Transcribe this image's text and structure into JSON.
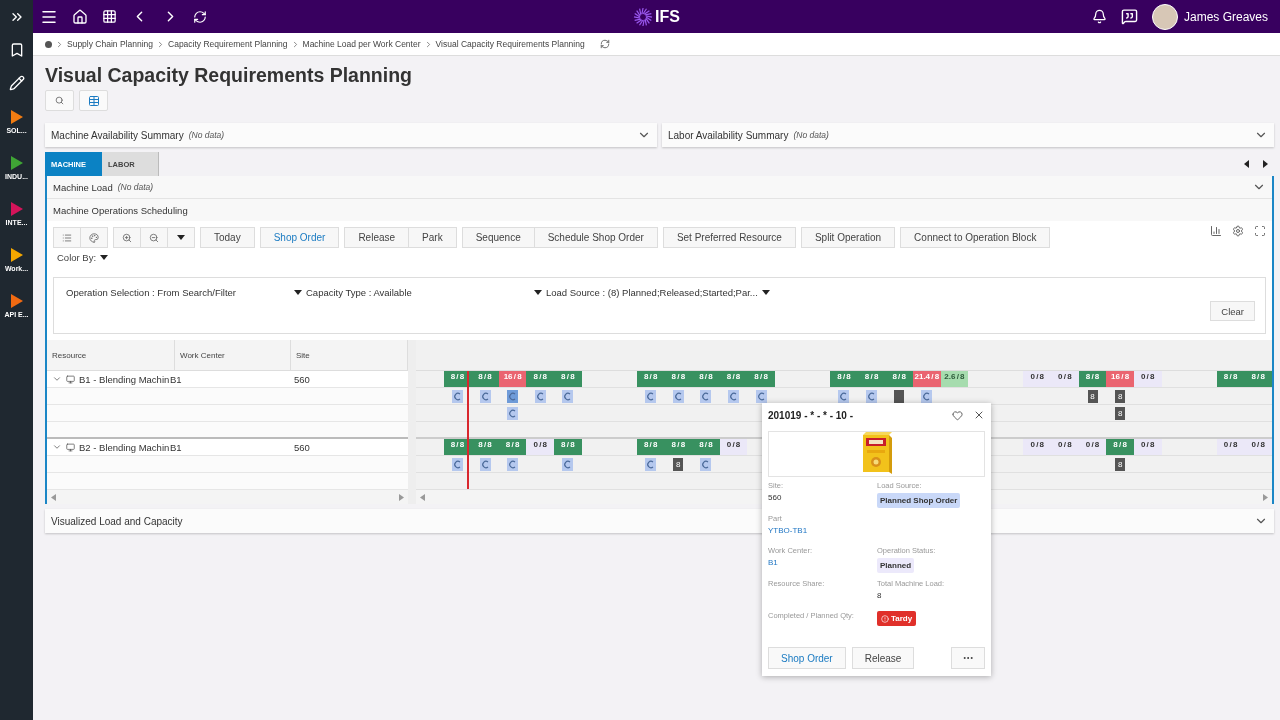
{
  "sidebar": {
    "items": [
      {
        "label": "SOL...",
        "color": "#f07c12"
      },
      {
        "label": "INDU...",
        "color": "#3fa535"
      },
      {
        "label": "INTE...",
        "color": "#d4145a"
      },
      {
        "label": "Work...",
        "color": "#f5a800"
      },
      {
        "label": "API E...",
        "color": "#f06a12"
      }
    ]
  },
  "topbar": {
    "logo": "IFS",
    "user": "James Greaves"
  },
  "breadcrumb": [
    "Supply Chain Planning",
    "Capacity Requirement Planning",
    "Machine Load per Work Center",
    "Visual Capacity Requirements Planning"
  ],
  "page": {
    "title": "Visual Capacity Requirements Planning"
  },
  "summaries": [
    {
      "title": "Machine Availability Summary",
      "note": "(No data)"
    },
    {
      "title": "Labor Availability Summary",
      "note": "(No data)"
    }
  ],
  "tabs": [
    {
      "label": "MACHINE",
      "selected": true
    },
    {
      "label": "LABOR",
      "selected": false
    }
  ],
  "machine_load": {
    "title": "Machine Load",
    "note": "(No data)"
  },
  "scheduling": {
    "title": "Machine Operations Scheduling",
    "toolbar": [
      [
        {
          "kind": "list"
        },
        {
          "kind": "palette"
        }
      ],
      [
        {
          "kind": "zoom-in"
        },
        {
          "kind": "zoom-out"
        },
        {
          "kind": "caret"
        }
      ],
      [
        {
          "kind": "text",
          "label": "Today",
          "primary": false
        }
      ],
      [
        {
          "kind": "text",
          "label": "Shop Order",
          "primary": true
        }
      ],
      [
        {
          "kind": "text",
          "label": "Release",
          "primary": false
        },
        {
          "kind": "text",
          "label": "Park",
          "primary": false
        }
      ],
      [
        {
          "kind": "text",
          "label": "Sequence",
          "primary": false
        },
        {
          "kind": "text",
          "label": "Schedule Shop Order",
          "primary": false
        }
      ],
      [
        {
          "kind": "text",
          "label": "Set Preferred Resource",
          "primary": false
        }
      ],
      [
        {
          "kind": "text",
          "label": "Split Operation",
          "primary": false
        }
      ],
      [
        {
          "kind": "text",
          "label": "Connect to Operation Block",
          "primary": false
        }
      ]
    ],
    "color_by": "Color By:",
    "filters": [
      "Operation Selection : From Search/Filter",
      "Capacity Type : Available",
      "Load Source : (8) Planned;Released;Started;Par..."
    ],
    "clear": "Clear",
    "columns": [
      "Resource",
      "Work Center",
      "Site"
    ],
    "resources": [
      {
        "resource": "B1 - Blending Machin",
        "work_center": "B1",
        "site": "560",
        "expanded": true,
        "load": [
          {
            "kind": "empty"
          },
          {
            "kind": "full",
            "label": "8 / 8"
          },
          {
            "kind": "full",
            "label": "8 / 8"
          },
          {
            "kind": "over",
            "label": "16 / 8"
          },
          {
            "kind": "full",
            "label": "8 / 8"
          },
          {
            "kind": "full",
            "label": "8 / 8"
          },
          {
            "kind": "empty"
          },
          {
            "kind": "empty"
          },
          {
            "kind": "full",
            "label": "8 / 8"
          },
          {
            "kind": "full",
            "label": "8 / 8"
          },
          {
            "kind": "full",
            "label": "8 / 8"
          },
          {
            "kind": "full",
            "label": "8 / 8"
          },
          {
            "kind": "full",
            "label": "8 / 8"
          },
          {
            "kind": "empty"
          },
          {
            "kind": "empty"
          },
          {
            "kind": "full",
            "label": "8 / 8"
          },
          {
            "kind": "full",
            "label": "8 / 8"
          },
          {
            "kind": "full",
            "label": "8 / 8"
          },
          {
            "kind": "over",
            "label": "21.4 / 8"
          },
          {
            "kind": "partial",
            "label": "2.6 / 8"
          },
          {
            "kind": "empty"
          },
          {
            "kind": "empty"
          },
          {
            "kind": "zero",
            "label": "0 / 8"
          },
          {
            "kind": "zero",
            "label": "0 / 8"
          },
          {
            "kind": "full",
            "label": "8 / 8"
          },
          {
            "kind": "over",
            "label": "16 / 8"
          },
          {
            "kind": "zero",
            "label": "0 / 8"
          },
          {
            "kind": "empty"
          },
          {
            "kind": "empty"
          },
          {
            "kind": "full",
            "label": "8 / 8"
          },
          {
            "kind": "full",
            "label": "8 / 8"
          }
        ],
        "sub_rows": [
          {
            "kind": "marks",
            "marks": [
              {
                "kind": "empty"
              },
              {
                "kind": "op"
              },
              {
                "kind": "op"
              },
              {
                "kind": "active"
              },
              {
                "kind": "op"
              },
              {
                "kind": "op"
              },
              {
                "kind": "empty"
              },
              {
                "kind": "empty"
              },
              {
                "kind": "op"
              },
              {
                "kind": "op"
              },
              {
                "kind": "op"
              },
              {
                "kind": "op"
              },
              {
                "kind": "op"
              },
              {
                "kind": "empty"
              },
              {
                "kind": "empty"
              },
              {
                "kind": "op"
              },
              {
                "kind": "op"
              },
              {
                "kind": "count"
              },
              {
                "kind": "op"
              },
              {
                "kind": "empty"
              },
              {
                "kind": "empty"
              },
              {
                "kind": "empty"
              },
              {
                "kind": "empty"
              },
              {
                "kind": "empty"
              },
              {
                "kind": "count",
                "label": "8"
              },
              {
                "kind": "count",
                "label": "8"
              }
            ]
          },
          {
            "kind": "marks",
            "marks": [
              {
                "kind": "empty"
              },
              {
                "kind": "empty"
              },
              {
                "kind": "empty"
              },
              {
                "kind": "op"
              },
              {
                "kind": "empty"
              },
              {
                "kind": "empty"
              },
              {
                "kind": "empty"
              },
              {
                "kind": "empty"
              },
              {
                "kind": "empty"
              },
              {
                "kind": "empty"
              },
              {
                "kind": "empty"
              },
              {
                "kind": "empty"
              },
              {
                "kind": "empty"
              },
              {
                "kind": "empty"
              },
              {
                "kind": "empty"
              },
              {
                "kind": "empty"
              },
              {
                "kind": "empty"
              },
              {
                "kind": "empty"
              },
              {
                "kind": "empty"
              },
              {
                "kind": "empty"
              },
              {
                "kind": "empty"
              },
              {
                "kind": "empty"
              },
              {
                "kind": "empty"
              },
              {
                "kind": "empty"
              },
              {
                "kind": "empty"
              },
              {
                "kind": "count",
                "label": "8"
              }
            ]
          },
          {
            "kind": "blank"
          }
        ]
      },
      {
        "resource": "B2 - Blending Machin",
        "work_center": "B1",
        "site": "560",
        "expanded": true,
        "load": [
          {
            "kind": "empty"
          },
          {
            "kind": "full",
            "label": "8 / 8"
          },
          {
            "kind": "full",
            "label": "8 / 8"
          },
          {
            "kind": "full",
            "label": "8 / 8"
          },
          {
            "kind": "zero",
            "label": "0 / 8"
          },
          {
            "kind": "full",
            "label": "8 / 8"
          },
          {
            "kind": "empty"
          },
          {
            "kind": "empty"
          },
          {
            "kind": "full",
            "label": "8 / 8"
          },
          {
            "kind": "full",
            "label": "8 / 8"
          },
          {
            "kind": "full",
            "label": "8 / 8"
          },
          {
            "kind": "zero",
            "label": "0 / 8"
          },
          {
            "kind": "empty"
          },
          {
            "kind": "empty"
          },
          {
            "kind": "empty"
          },
          {
            "kind": "empty"
          },
          {
            "kind": "empty"
          },
          {
            "kind": "empty"
          },
          {
            "kind": "empty"
          },
          {
            "kind": "empty"
          },
          {
            "kind": "empty"
          },
          {
            "kind": "empty"
          },
          {
            "kind": "zero",
            "label": "0 / 8"
          },
          {
            "kind": "zero",
            "label": "0 / 8"
          },
          {
            "kind": "zero",
            "label": "0 / 8"
          },
          {
            "kind": "full",
            "label": "8 / 8"
          },
          {
            "kind": "zero",
            "label": "0 / 8"
          },
          {
            "kind": "empty"
          },
          {
            "kind": "empty"
          },
          {
            "kind": "zero",
            "label": "0 / 8"
          },
          {
            "kind": "zero",
            "label": "0 / 8"
          }
        ],
        "sub_rows": [
          {
            "kind": "marks",
            "marks": [
              {
                "kind": "empty"
              },
              {
                "kind": "op"
              },
              {
                "kind": "op"
              },
              {
                "kind": "op"
              },
              {
                "kind": "empty"
              },
              {
                "kind": "op"
              },
              {
                "kind": "empty"
              },
              {
                "kind": "empty"
              },
              {
                "kind": "op"
              },
              {
                "kind": "count",
                "label": "8"
              },
              {
                "kind": "op"
              },
              {
                "kind": "empty"
              },
              {
                "kind": "empty"
              },
              {
                "kind": "empty"
              },
              {
                "kind": "empty"
              },
              {
                "kind": "empty"
              },
              {
                "kind": "empty"
              },
              {
                "kind": "empty"
              },
              {
                "kind": "empty"
              },
              {
                "kind": "empty"
              },
              {
                "kind": "empty"
              },
              {
                "kind": "empty"
              },
              {
                "kind": "empty"
              },
              {
                "kind": "empty"
              },
              {
                "kind": "empty"
              },
              {
                "kind": "count",
                "label": "8"
              }
            ]
          },
          {
            "kind": "blank"
          }
        ]
      }
    ]
  },
  "visualized": {
    "title": "Visualized Load and Capacity"
  },
  "popup": {
    "title": "201019 - * - * - 10 -",
    "image": {
      "kind": "picture"
    },
    "rows": [
      [
        {
          "label": "Site:",
          "value": "560",
          "kind": "plain"
        },
        {
          "label": "Load Source:",
          "value": "Planned Shop Order",
          "kind": "tag",
          "color": "#c9d8f8"
        }
      ],
      [
        {
          "label": "Part",
          "value": "YTBO-TB1",
          "kind": "link"
        }
      ],
      [
        {
          "label": "Work Center:",
          "value": "B1",
          "kind": "link"
        },
        {
          "label": "Operation Status:",
          "value": "Planned",
          "kind": "tag",
          "color": "#ece9fb"
        }
      ],
      [
        {
          "label": "Resource Share:"
        },
        {
          "label": "Total Machine Load:",
          "value": "8",
          "kind": "plain"
        }
      ],
      [
        {
          "label": "Completed / Planned Qty:"
        },
        {
          "value": "Tardy",
          "kind": "alert"
        }
      ]
    ],
    "actions": [
      "Shop Order",
      "Release"
    ]
  }
}
